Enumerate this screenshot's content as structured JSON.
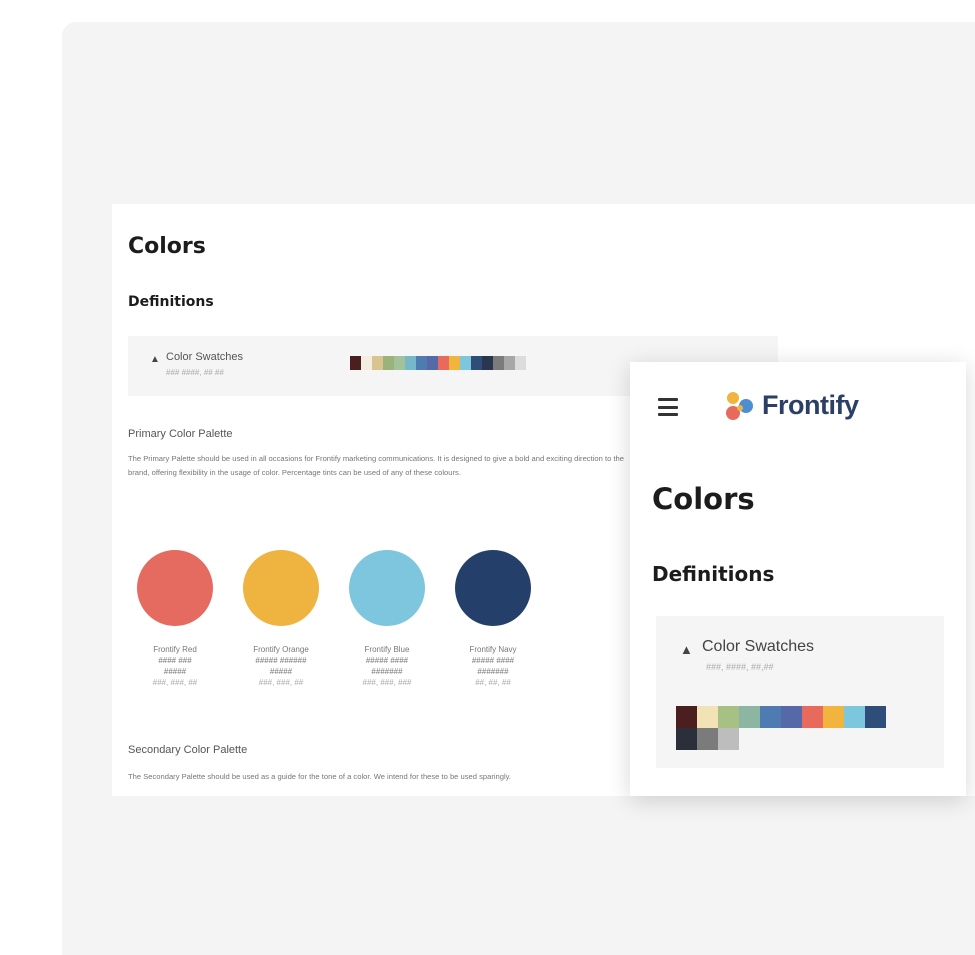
{
  "desktop": {
    "title": "Colors",
    "section": "Definitions",
    "swatch_block": {
      "title": "Color Swatches",
      "subtitle": "### ####, ## ##",
      "colors": [
        "#4b1f1f",
        "#f4ede0",
        "#d7c48e",
        "#9bb27a",
        "#a3c29a",
        "#76b7c9",
        "#4d7bb2",
        "#5568a8",
        "#e86a5c",
        "#f1b43e",
        "#7cc7dd",
        "#2e4d78",
        "#2a3550",
        "#7b7b7b",
        "#a7a7a7",
        "#dcdcdc"
      ]
    },
    "primary": {
      "title": "Primary Color Palette",
      "text": "The Primary Palette should be used in all occasions for Frontify marketing communications. It is designed to give a bold and exciting direction to the brand, offering flexibility in the usage of color. Percentage tints can be used of any of these colours."
    },
    "colors": [
      {
        "hex": "#e56a5f",
        "name": "Frontify Red",
        "line2": "#### ###",
        "line3": "#####",
        "line4": "###, ###, ##"
      },
      {
        "hex": "#efb33f",
        "name": "Frontify Orange",
        "line2": "##### ######",
        "line3": "#####",
        "line4": "###, ###, ##"
      },
      {
        "hex": "#7ec6dd",
        "name": "Frontify Blue",
        "line2": "##### ####",
        "line3": "#######",
        "line4": "###, ###, ###"
      },
      {
        "hex": "#24406a",
        "name": "Frontify Navy",
        "line2": "##### ####",
        "line3": "#######",
        "line4": "##, ##, ##"
      }
    ],
    "secondary": {
      "title": "Secondary Color Palette",
      "text": "The Secondary Palette should be used as a guide for the tone of a color. We intend for these to be used sparingly."
    }
  },
  "mobile": {
    "brand": "Frontify",
    "title": "Colors",
    "section": "Definitions",
    "swatch_block": {
      "title": "Color Swatches",
      "subtitle": "###, ####, ##,##",
      "row1": [
        "#4b1f1f",
        "#f1e3b6",
        "#a6c183",
        "#8db6a2",
        "#4d7bb2",
        "#5568a8",
        "#e86a5c",
        "#f1b43e",
        "#7cc7dd",
        "#2e4d78"
      ],
      "row2": [
        "#2a2f3a",
        "#7b7b7b",
        "#bdbdbd"
      ]
    }
  }
}
